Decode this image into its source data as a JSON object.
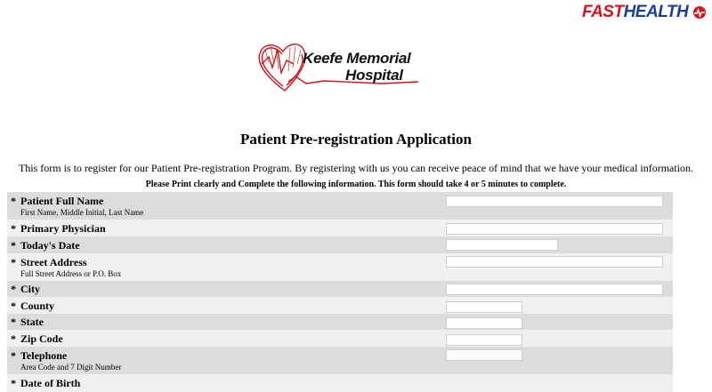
{
  "brand": {
    "fast": "FAST",
    "heal": "HEALTH"
  },
  "logo": {
    "line1": "Keefe Memorial",
    "line2": "Hospital"
  },
  "page": {
    "title": "Patient Pre-registration Application",
    "intro": "This form is to register for our Patient Pre-registration Program. By registering with us you can receive peace of mind that we have your medical information.",
    "instructions": "Please Print clearly and Complete the following information. This form should take 4 or 5 minutes to complete."
  },
  "fields": [
    {
      "required": "*",
      "label": "Patient Full Name",
      "hint": "First Name, Middle Initial, Last Name",
      "value": ""
    },
    {
      "required": "*",
      "label": "Primary Physician",
      "hint": "",
      "value": ""
    },
    {
      "required": "*",
      "label": "Today's Date",
      "hint": "",
      "value": ""
    },
    {
      "required": "*",
      "label": "Street Address",
      "hint": "Full Street Address or P.O. Box",
      "value": ""
    },
    {
      "required": "*",
      "label": "City",
      "hint": "",
      "value": ""
    },
    {
      "required": "*",
      "label": "County",
      "hint": "",
      "value": ""
    },
    {
      "required": "*",
      "label": "State",
      "hint": "",
      "value": ""
    },
    {
      "required": "*",
      "label": "Zip Code",
      "hint": "",
      "value": ""
    },
    {
      "required": "*",
      "label": "Telephone",
      "hint": "Area Code and 7 Digit Number",
      "value": ""
    },
    {
      "required": "*",
      "label": "Date of Birth",
      "hint": "",
      "value": ""
    }
  ]
}
